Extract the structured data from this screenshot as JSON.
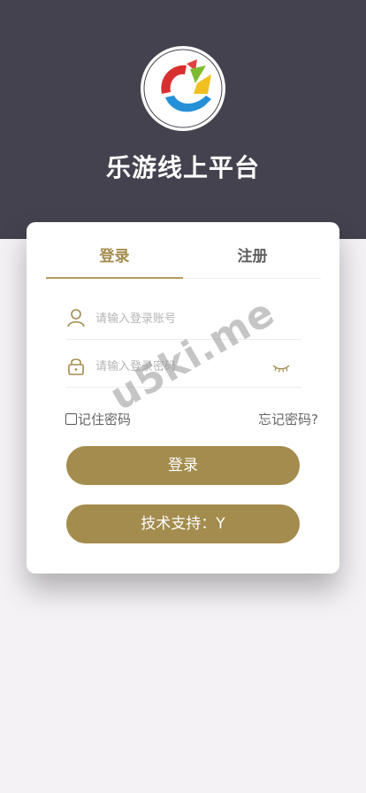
{
  "app": {
    "title": "乐游线上平台"
  },
  "tabs": [
    {
      "label": "登录",
      "active": true
    },
    {
      "label": "注册",
      "active": false
    }
  ],
  "form": {
    "username_placeholder": "请输入登录账号",
    "password_placeholder": "请输入登录密码",
    "remember_label": "记住密码",
    "forgot_label": "忘记密码?",
    "login_button": "登录",
    "support_button": "技术支持：Y"
  },
  "watermark": "u5ki.me",
  "colors": {
    "header_bg": "#45424f",
    "accent": "#a38c4d",
    "page_bg": "#f4f2f5"
  },
  "icons": [
    "user-icon",
    "lock-icon",
    "eye-closed-icon",
    "app-logo"
  ]
}
